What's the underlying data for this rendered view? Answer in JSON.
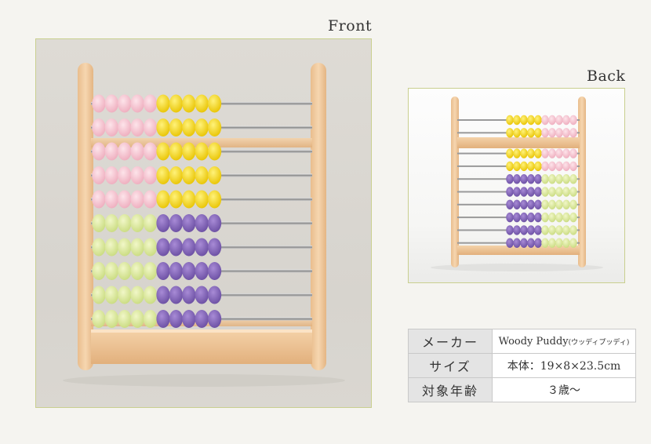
{
  "front": {
    "label": "Front"
  },
  "back": {
    "label": "Back"
  },
  "specs": [
    {
      "key": "メーカー",
      "value": "Woody Puddy",
      "value_note": "(ウッディプッディ)"
    },
    {
      "key": "サイズ",
      "value": "本体：19×8×23.5cm"
    },
    {
      "key": "対象年齢",
      "value": "３歳～"
    }
  ],
  "colors": {
    "pink": "#f6c1cd",
    "yellow": "#f3d40e",
    "green": "#d8e79a",
    "purple": "#7a5fb0",
    "wood": "#efc89d",
    "frame_border": "#c9cf8f"
  }
}
